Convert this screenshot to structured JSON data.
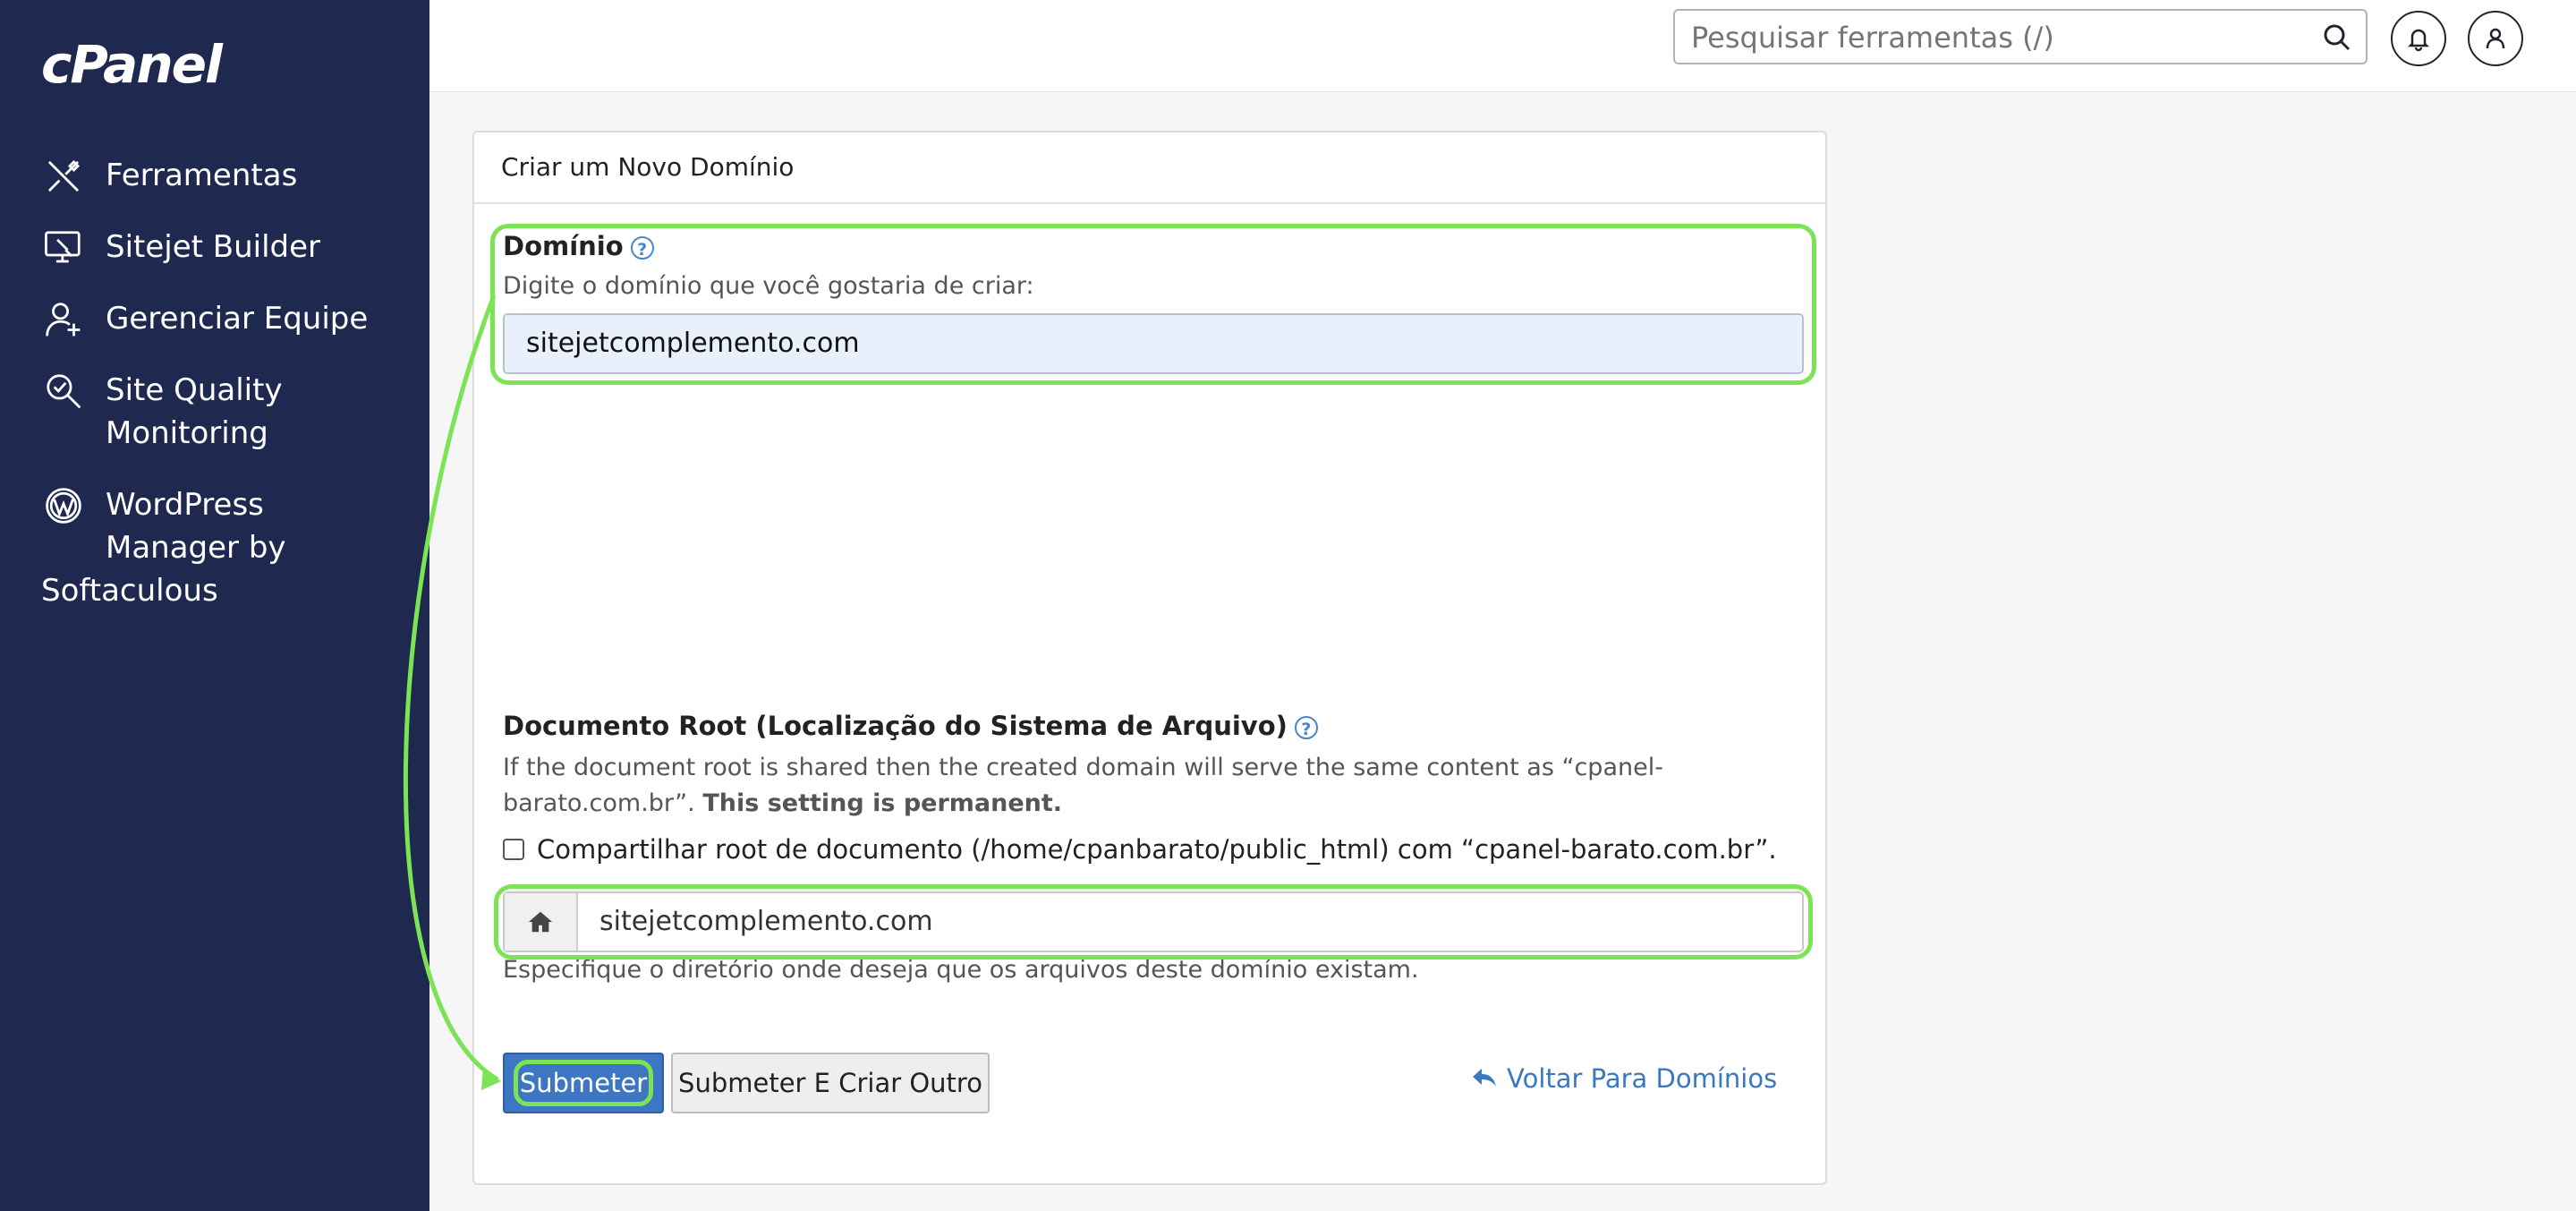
{
  "sidebar": {
    "logo": "cPanel",
    "items": [
      {
        "label": "Ferramentas"
      },
      {
        "label": "Sitejet Builder"
      },
      {
        "label": "Gerenciar Equipe"
      },
      {
        "label_line1": "Site Quality",
        "label_line2": "Monitoring"
      },
      {
        "label_line1": "WordPress",
        "label_line2": "Manager by",
        "label_line3": "Softaculous"
      }
    ]
  },
  "topbar": {
    "search_placeholder": "Pesquisar ferramentas (/)"
  },
  "panel": {
    "title": "Criar um Novo Domínio",
    "domain": {
      "label": "Domínio",
      "hint": "Digite o domínio que você gostaria de criar:",
      "value": "sitejetcomplemento.com"
    },
    "docroot": {
      "label": "Documento Root (Localização do Sistema de Arquivo)",
      "text_regular": "If the document root is shared then the created domain will serve the same content as “cpanel-barato.com.br”.",
      "text_bold": "This setting is permanent.",
      "checkbox_label": "Compartilhar root de documento (/home/cpanbarato/public_html) com “cpanel-barato.com.br”.",
      "path_value": "sitejetcomplemento.com",
      "path_hint": "Especifique o diretório onde deseja que os arquivos deste domínio existam."
    },
    "buttons": {
      "submit": "Submeter",
      "submit_another": "Submeter E Criar Outro",
      "back": "Voltar Para Domínios"
    }
  },
  "colors": {
    "sidebar_bg": "#1f2950",
    "accent_blue": "#3d76c2",
    "highlight_green": "#7be354"
  }
}
